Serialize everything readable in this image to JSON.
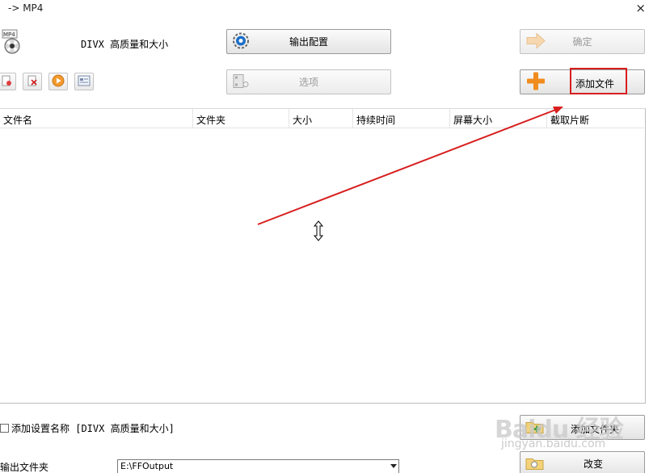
{
  "window": {
    "title": "-> MP4",
    "close_glyph": "×"
  },
  "profile": {
    "icon": "mp4-film-icon",
    "icon_text": "MP4",
    "name": "DIVX 高质量和大小"
  },
  "buttons": {
    "output_config": "输出配置",
    "ok": "确定",
    "options": "选项",
    "add_file": "添加文件",
    "add_folder": "添加文件夹",
    "change": "改变"
  },
  "toolbar_icons": [
    "remove-file-icon",
    "clear-list-icon",
    "play-icon",
    "media-info-icon"
  ],
  "file_list": {
    "columns": [
      "文件名",
      "文件夹",
      "大小",
      "持续时间",
      "屏幕大小",
      "截取片断"
    ],
    "rows": []
  },
  "append_setting": {
    "checked": false,
    "label": "添加设置名称 [DIVX 高质量和大小]"
  },
  "output": {
    "label": "输出文件夹",
    "value": "E:\\FFOutput"
  },
  "watermark": {
    "brand": "Baidu 经验",
    "url": "jingyan.baidu.com"
  },
  "colors": {
    "annotation_red": "#d81e1e",
    "add_plus_orange": "#f08c1e"
  }
}
